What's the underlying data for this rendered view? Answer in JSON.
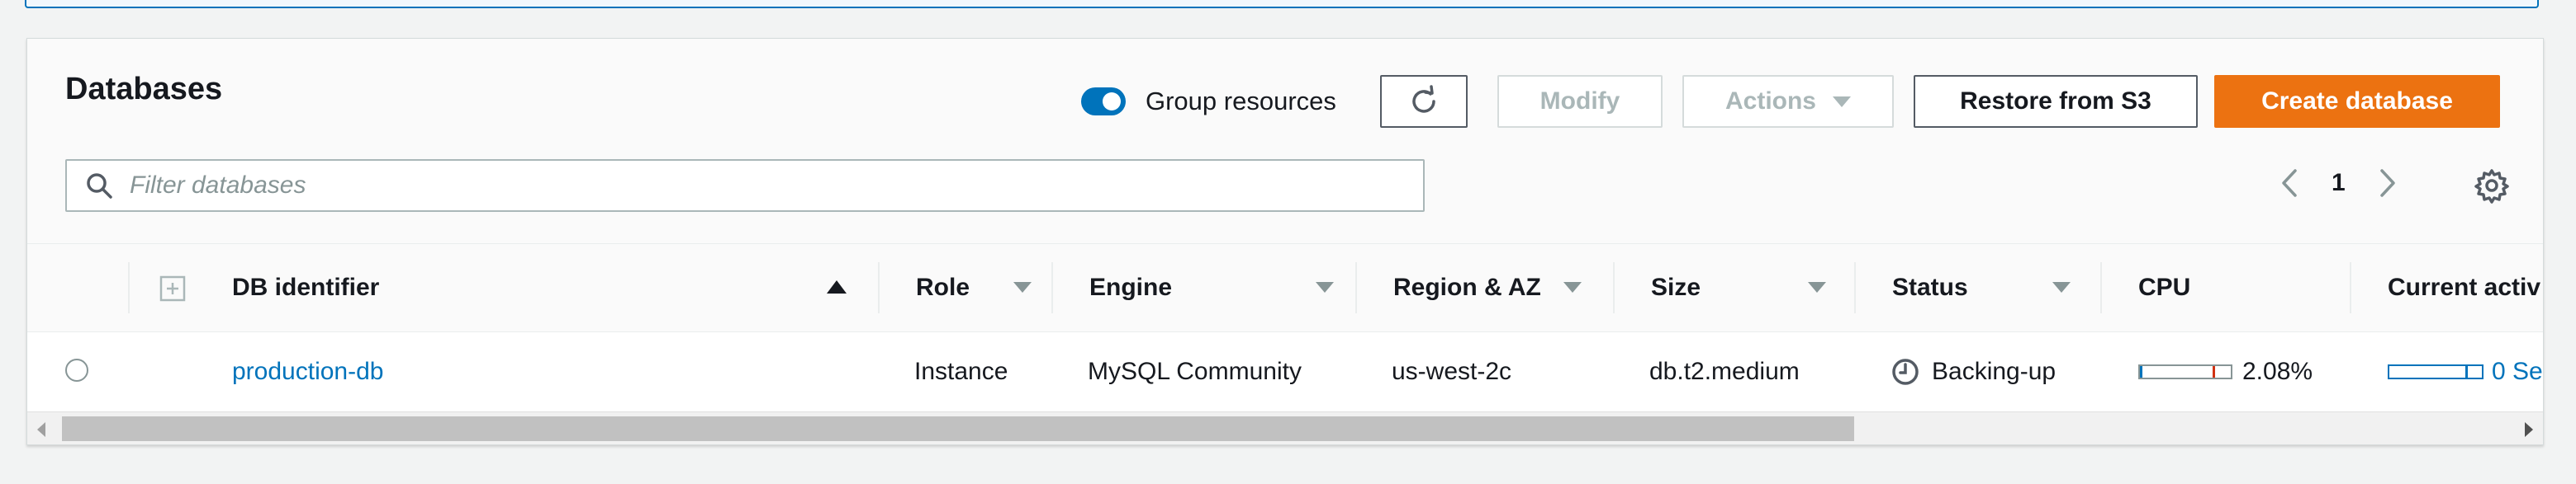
{
  "header": {
    "title": "Databases",
    "group_resources_label": "Group resources",
    "group_resources_on": true
  },
  "toolbar": {
    "refresh_icon": "refresh-icon",
    "modify_label": "Modify",
    "actions_label": "Actions",
    "restore_label": "Restore from S3",
    "create_label": "Create database"
  },
  "filter": {
    "placeholder": "Filter databases"
  },
  "pagination": {
    "current_page": "1"
  },
  "table": {
    "columns": [
      "DB identifier",
      "Role",
      "Engine",
      "Region & AZ",
      "Size",
      "Status",
      "CPU",
      "Current activ"
    ],
    "rows": [
      {
        "db_identifier": "production-db",
        "role": "Instance",
        "engine": "MySQL Community",
        "region_az": "us-west-2c",
        "size": "db.t2.medium",
        "status": "Backing-up",
        "cpu": "2.08%",
        "cpu_fraction": 0.0208,
        "current_activity": "0 Ses"
      }
    ]
  },
  "colors": {
    "accent": "#0073bb",
    "primary_button": "#ec7211",
    "cpu_marker": "#d13212"
  }
}
